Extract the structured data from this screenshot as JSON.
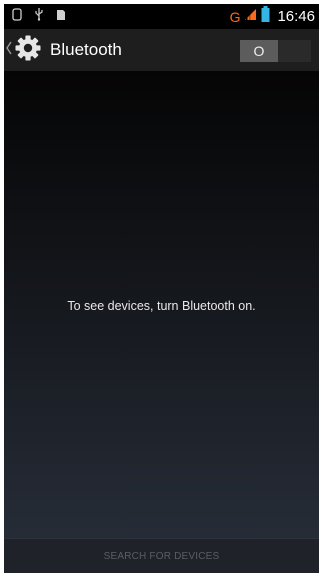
{
  "status_bar": {
    "left_icons": [
      "screenshot-icon",
      "usb-icon",
      "sd-card-icon"
    ],
    "network_type": "G",
    "signal_icon": "signal-icon",
    "battery_icon": "battery-icon",
    "time": "16:46",
    "colors": {
      "network": "#ff6a1a",
      "signal": "#ff6a1a",
      "battery": "#33b5e5"
    }
  },
  "action_bar": {
    "up_icon": "chevron-left-icon",
    "app_icon": "settings-gear-icon",
    "title": "Bluetooth",
    "toggle": {
      "label": "O",
      "state": "off"
    }
  },
  "content": {
    "message": "To see devices, turn Bluetooth on."
  },
  "bottom": {
    "search_label": "SEARCH FOR DEVICES",
    "enabled": false
  }
}
